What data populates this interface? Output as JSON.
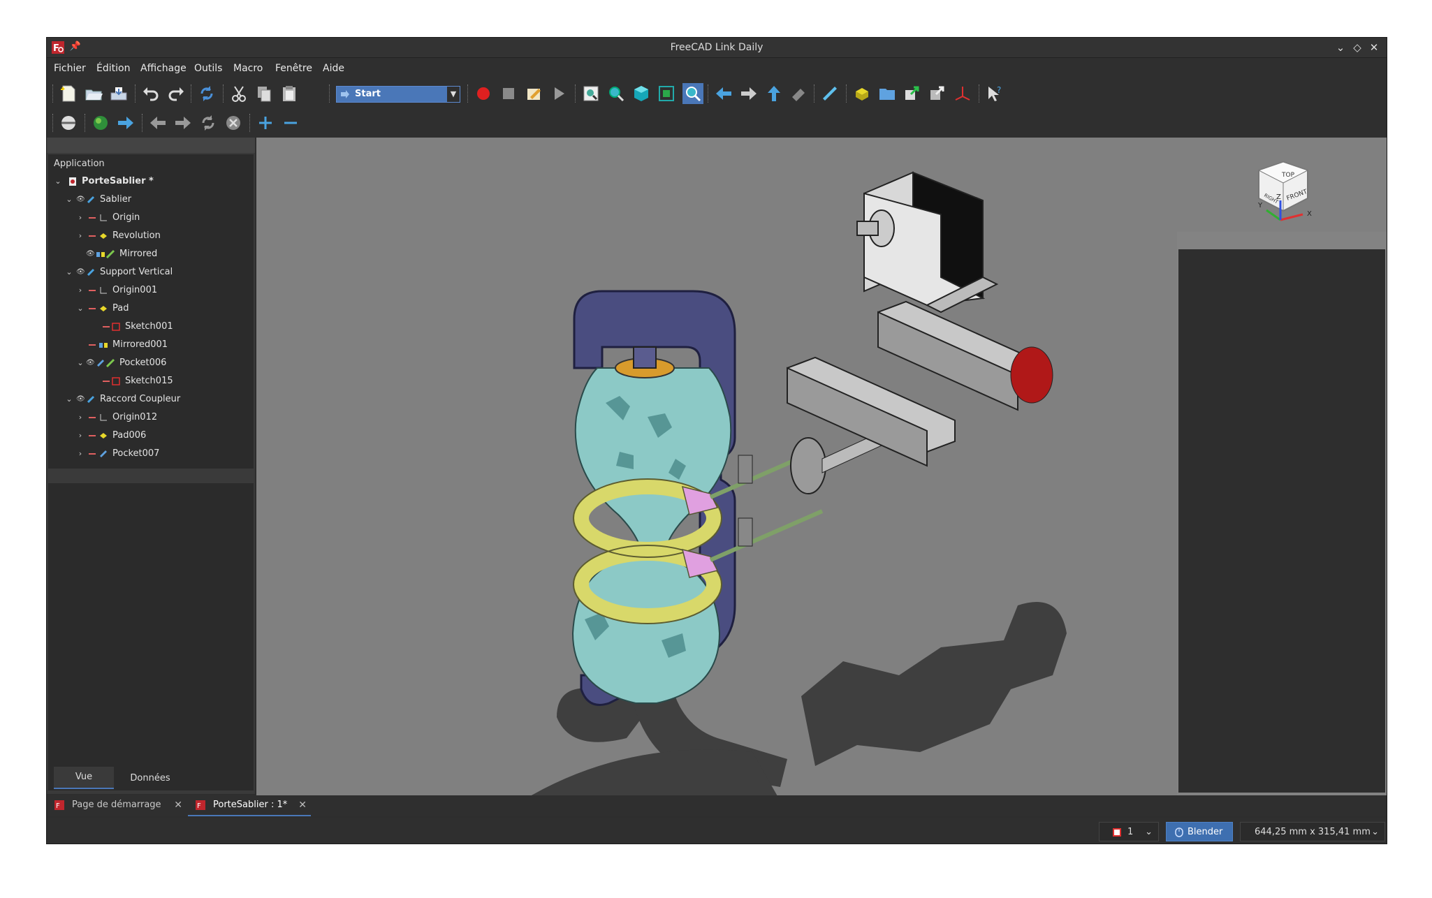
{
  "window": {
    "title": "FreeCAD Link Daily"
  },
  "menu": [
    "Fichier",
    "Édition",
    "Affichage",
    "Outils",
    "Macro",
    "Fenêtre",
    "Aide"
  ],
  "workbench": {
    "selected": "Start"
  },
  "tree": {
    "header": "Application",
    "items": [
      {
        "label": "PorteSablier *",
        "bold": true
      },
      {
        "label": "Sablier"
      },
      {
        "label": "Origin"
      },
      {
        "label": "Revolution"
      },
      {
        "label": "Mirrored"
      },
      {
        "label": "Support Vertical"
      },
      {
        "label": "Origin001"
      },
      {
        "label": "Pad"
      },
      {
        "label": "Sketch001"
      },
      {
        "label": "Mirrored001"
      },
      {
        "label": "Pocket006"
      },
      {
        "label": "Sketch015"
      },
      {
        "label": "Raccord Coupleur"
      },
      {
        "label": "Origin012"
      },
      {
        "label": "Pad006"
      },
      {
        "label": "Pocket007"
      }
    ]
  },
  "property_tabs": [
    "Vue",
    "Données"
  ],
  "view_cube": {
    "front": "FRONT",
    "top": "TOP",
    "right": "RIGHT",
    "axis_x": "X",
    "axis_y": "Y",
    "axis_z": "Z"
  },
  "doc_tabs": [
    {
      "label": "Page de démarrage",
      "active": false
    },
    {
      "label": "PorteSablier : 1*",
      "active": true
    }
  ],
  "status": {
    "page": "1",
    "nav_style": "Blender",
    "dimensions": "644,25 mm x 315,41 mm"
  },
  "colors": {
    "accent": "#4a77b8",
    "background": "#2e2e2e",
    "viewport": "#808080"
  }
}
